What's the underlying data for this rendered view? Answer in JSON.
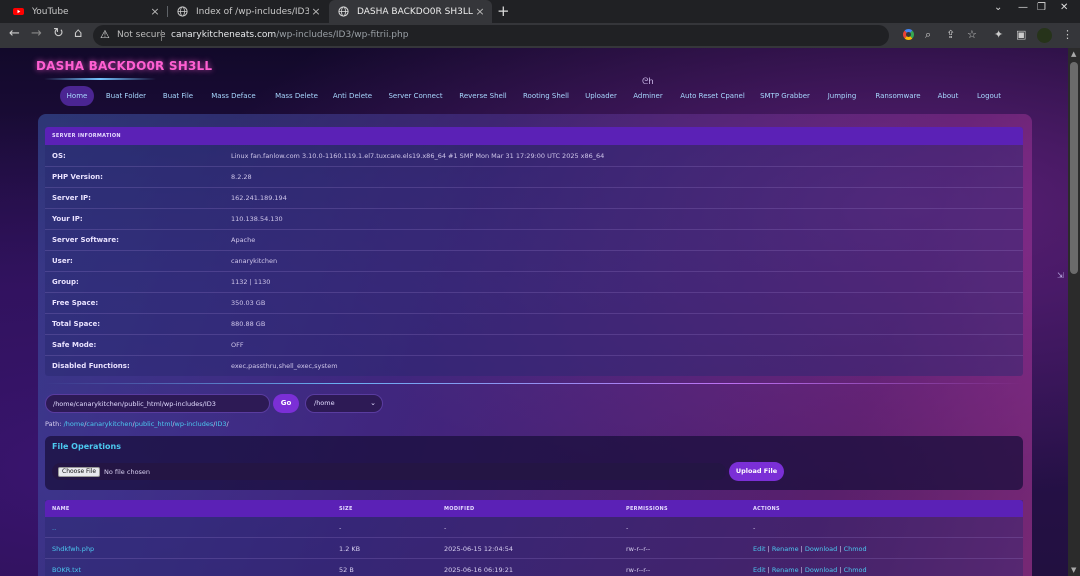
{
  "browser": {
    "tabs": [
      {
        "title": "YouTube",
        "close": "×"
      },
      {
        "title": "Index of /wp-includes/ID3",
        "close": "×"
      },
      {
        "title": "DASHA BACKDO0R SH3LL",
        "close": "×"
      }
    ],
    "new_tab": "+",
    "window_controls": {
      "down": "⌄",
      "minimize": "—",
      "restore": "❐",
      "close": "✕"
    },
    "nav": {
      "back": "←",
      "forward": "→",
      "reload": "↻",
      "home": "⌂"
    },
    "security_icon": "⚠",
    "security_label": "Not secure",
    "url_domain": "canarykitcheneats.com",
    "url_path": "/wp-includes/ID3/wp-fitrii.php",
    "toolbar_icons": {
      "zoom": "⌕",
      "share": "⇪",
      "bookmark": "☆",
      "extensions": "✦",
      "sidepanel": "▣",
      "menu": "⋮"
    }
  },
  "header": {
    "title": "DASHA BACKDO0R SH3LL",
    "glyph": "ᘓ𐌷"
  },
  "nav": [
    {
      "label": "Home",
      "active": true
    },
    {
      "label": "Buat Folder"
    },
    {
      "label": "Buat File"
    },
    {
      "label": "Mass Deface"
    },
    {
      "label": "Mass Delete"
    },
    {
      "label": "Anti Delete"
    },
    {
      "label": "Server Connect"
    },
    {
      "label": "Reverse Shell"
    },
    {
      "label": "Rooting Shell"
    },
    {
      "label": "Uploader"
    },
    {
      "label": "Adminer"
    },
    {
      "label": "Auto Reset Cpanel"
    },
    {
      "label": "SMTP Grabber"
    },
    {
      "label": "Jumping"
    },
    {
      "label": "Ransomware"
    },
    {
      "label": "About"
    },
    {
      "label": "Logout"
    }
  ],
  "server_info": {
    "heading": "SERVER INFORMATION",
    "rows": [
      {
        "key": "OS:",
        "value": "Linux fan.fanlow.com 3.10.0-1160.119.1.el7.tuxcare.els19.x86_64 #1 SMP Mon Mar 31 17:29:00 UTC 2025 x86_64"
      },
      {
        "key": "PHP Version:",
        "value": "8.2.28"
      },
      {
        "key": "Server IP:",
        "value": "162.241.189.194"
      },
      {
        "key": "Your IP:",
        "value": "110.138.54.130"
      },
      {
        "key": "Server Software:",
        "value": "Apache"
      },
      {
        "key": "User:",
        "value": "canarykitchen"
      },
      {
        "key": "Group:",
        "value": "1132 | 1130"
      },
      {
        "key": "Free Space:",
        "value": "350.03 GB"
      },
      {
        "key": "Total Space:",
        "value": "880.88 GB"
      },
      {
        "key": "Safe Mode:",
        "value": "OFF"
      },
      {
        "key": "Disabled Functions:",
        "value": "exec,passthru,shell_exec,system"
      }
    ]
  },
  "path_form": {
    "current_path": "/home/canarykitchen/public_html/wp-includes/ID3",
    "go_label": "Go",
    "select_value": "/home",
    "select_chevron": "⌄"
  },
  "breadcrumb": {
    "label": "Path:",
    "parts": [
      "/",
      "home",
      "/",
      "canarykitchen",
      "/",
      "public_html",
      "/",
      "wp-includes",
      "/",
      "ID3",
      "/"
    ]
  },
  "file_ops": {
    "title": "File Operations",
    "choose_label": "Choose File",
    "no_file": "No file chosen",
    "upload_label": "Upload File"
  },
  "file_table": {
    "columns": [
      "NAME",
      "SIZE",
      "MODIFIED",
      "PERMISSIONS",
      "ACTIONS"
    ],
    "rows": [
      {
        "name": "..",
        "size": "-",
        "modified": "-",
        "perms": "-",
        "actions": "-"
      },
      {
        "name": "Shdkfwh.php",
        "size": "1.2 KB",
        "modified": "2025-06-15 12:04:54",
        "perms": "rw-r--r--",
        "actions": [
          "Edit",
          "Rename",
          "Download",
          "Chmod"
        ]
      },
      {
        "name": "BOKR.txt",
        "size": "52 B",
        "modified": "2025-06-16 06:19:21",
        "perms": "rw-r--r--",
        "actions": [
          "Edit",
          "Rename",
          "Download",
          "Chmod"
        ]
      }
    ],
    "action_separator": " | "
  },
  "side_arrow": "⇲"
}
